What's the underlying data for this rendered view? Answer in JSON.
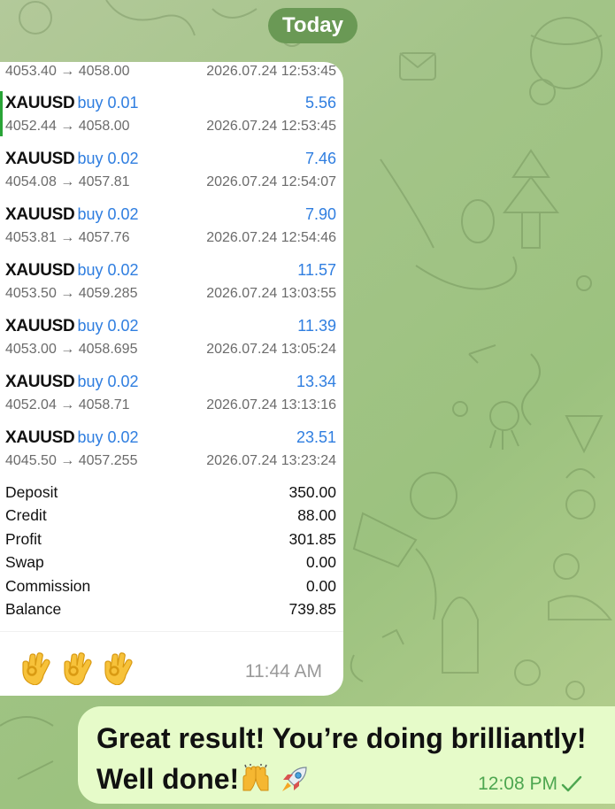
{
  "date_separator": "Today",
  "incoming_message": {
    "trades": [
      {
        "prices": "4053.40 → 4058.00",
        "time": "2026.07.24 12:53:45"
      },
      {
        "symbol": "XAUUSD",
        "side": "buy 0.01",
        "profit": "5.56",
        "prices": "4052.44 → 4058.00",
        "time": "2026.07.24 12:53:45"
      },
      {
        "symbol": "XAUUSD",
        "side": "buy 0.02",
        "profit": "7.46",
        "prices": "4054.08 → 4057.81",
        "time": "2026.07.24 12:54:07"
      },
      {
        "symbol": "XAUUSD",
        "side": "buy 0.02",
        "profit": "7.90",
        "prices": "4053.81 → 4057.76",
        "time": "2026.07.24 12:54:46"
      },
      {
        "symbol": "XAUUSD",
        "side": "buy 0.02",
        "profit": "11.57",
        "prices": "4053.50 → 4059.285",
        "time": "2026.07.24 13:03:55"
      },
      {
        "symbol": "XAUUSD",
        "side": "buy 0.02",
        "profit": "11.39",
        "prices": "4053.00 → 4058.695",
        "time": "2026.07.24 13:05:24"
      },
      {
        "symbol": "XAUUSD",
        "side": "buy 0.02",
        "profit": "13.34",
        "prices": "4052.04 → 4058.71",
        "time": "2026.07.24 13:13:16"
      },
      {
        "symbol": "XAUUSD",
        "side": "buy 0.02",
        "profit": "23.51",
        "prices": "4045.50 → 4057.255",
        "time": "2026.07.24 13:23:24"
      }
    ],
    "summary": [
      {
        "label": "Deposit",
        "value": "350.00"
      },
      {
        "label": "Credit",
        "value": "88.00"
      },
      {
        "label": "Profit",
        "value": "301.85"
      },
      {
        "label": "Swap",
        "value": "0.00"
      },
      {
        "label": "Commission",
        "value": "0.00"
      },
      {
        "label": "Balance",
        "value": "739.85"
      }
    ],
    "reactions": [
      "ok-hand-icon",
      "ok-hand-icon",
      "ok-hand-icon"
    ],
    "time": "11:44 AM"
  },
  "outgoing_message": {
    "line1": "Great result! You’re doing brilliantly!",
    "line2": "Well done!",
    "emojis": [
      "raising-hands-icon",
      "rocket-icon"
    ],
    "time": "12:08 PM",
    "status_icon": "read-check-icon"
  },
  "colors": {
    "accent_blue": "#2f7ee0",
    "outgoing_bubble": "#e6fbc9",
    "outgoing_time": "#4da650",
    "date_pill": "#6a9955",
    "selected_marker": "#29a437"
  }
}
